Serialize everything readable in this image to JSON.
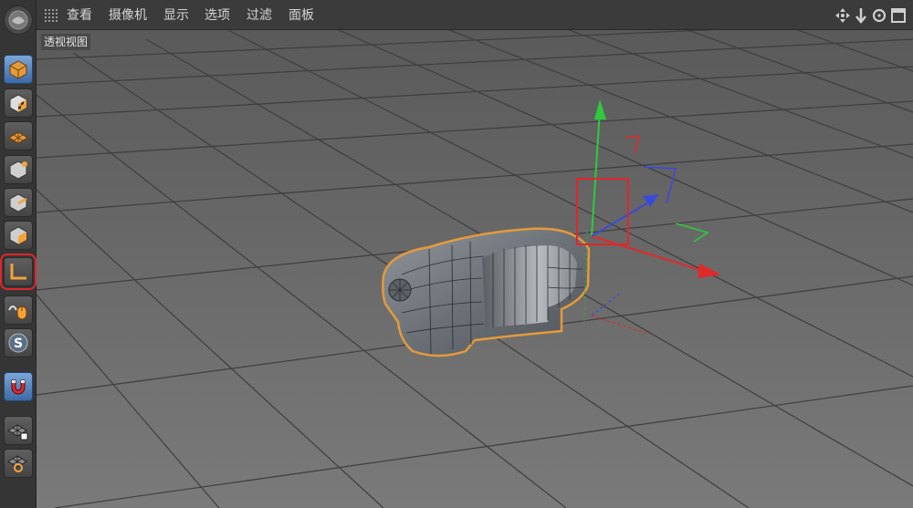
{
  "menu": {
    "items": [
      {
        "label": "查看"
      },
      {
        "label": "摄像机"
      },
      {
        "label": "显示"
      },
      {
        "label": "选项"
      },
      {
        "label": "过滤"
      },
      {
        "label": "面板"
      }
    ],
    "nav_icons": [
      "move-view-icon",
      "dolly-view-icon",
      "rotate-view-icon",
      "maximize-view-icon"
    ]
  },
  "viewport": {
    "label": "透视视图"
  },
  "toolbar": {
    "tools": [
      {
        "name": "app-logo-icon"
      },
      {
        "name": "model-mode-icon"
      },
      {
        "name": "texture-mode-icon"
      },
      {
        "name": "workplane-mode-icon"
      },
      {
        "name": "points-mode-icon"
      },
      {
        "name": "edges-mode-icon"
      },
      {
        "name": "polygons-mode-icon"
      },
      {
        "name": "axis-mode-icon",
        "highlighted": true
      },
      {
        "name": "tweak-mode-icon"
      },
      {
        "name": "solo-mode-icon"
      },
      {
        "name": "snap-magnet-icon"
      },
      {
        "name": "workplane-lock-icon"
      },
      {
        "name": "workplane-align-icon"
      }
    ]
  },
  "colors": {
    "selection_outline": "#e59a3a",
    "axis_x": "#e02a2a",
    "axis_y": "#2ccb3b",
    "axis_z": "#3a4ad8",
    "highlight_box": "#e2262b"
  }
}
